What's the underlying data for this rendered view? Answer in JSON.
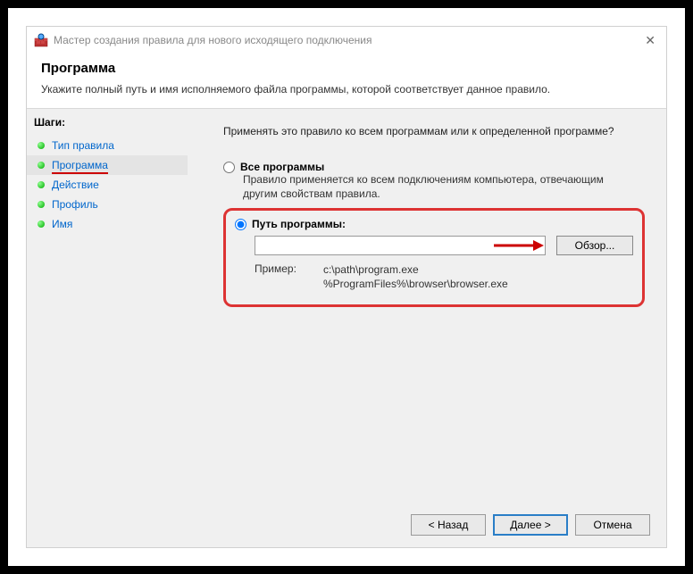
{
  "window": {
    "title": "Мастер создания правила для нового исходящего подключения"
  },
  "header": {
    "title": "Программа",
    "subtitle": "Укажите полный путь и имя исполняемого файла программы, которой соответствует данное правило."
  },
  "sidebar": {
    "label": "Шаги:",
    "items": [
      {
        "label": "Тип правила"
      },
      {
        "label": "Программа"
      },
      {
        "label": "Действие"
      },
      {
        "label": "Профиль"
      },
      {
        "label": "Имя"
      }
    ]
  },
  "content": {
    "question": "Применять это правило ко всем программам или к определенной программе?",
    "option_all": {
      "label": "Все программы",
      "desc": "Правило применяется ко всем подключениям компьютера, отвечающим другим свойствам правила."
    },
    "option_path": {
      "label": "Путь программы:",
      "input_value": "",
      "browse": "Обзор...",
      "example_label": "Пример:",
      "example_path1": "c:\\path\\program.exe",
      "example_path2": "%ProgramFiles%\\browser\\browser.exe"
    }
  },
  "footer": {
    "back": "< Назад",
    "next": "Далее >",
    "cancel": "Отмена"
  }
}
